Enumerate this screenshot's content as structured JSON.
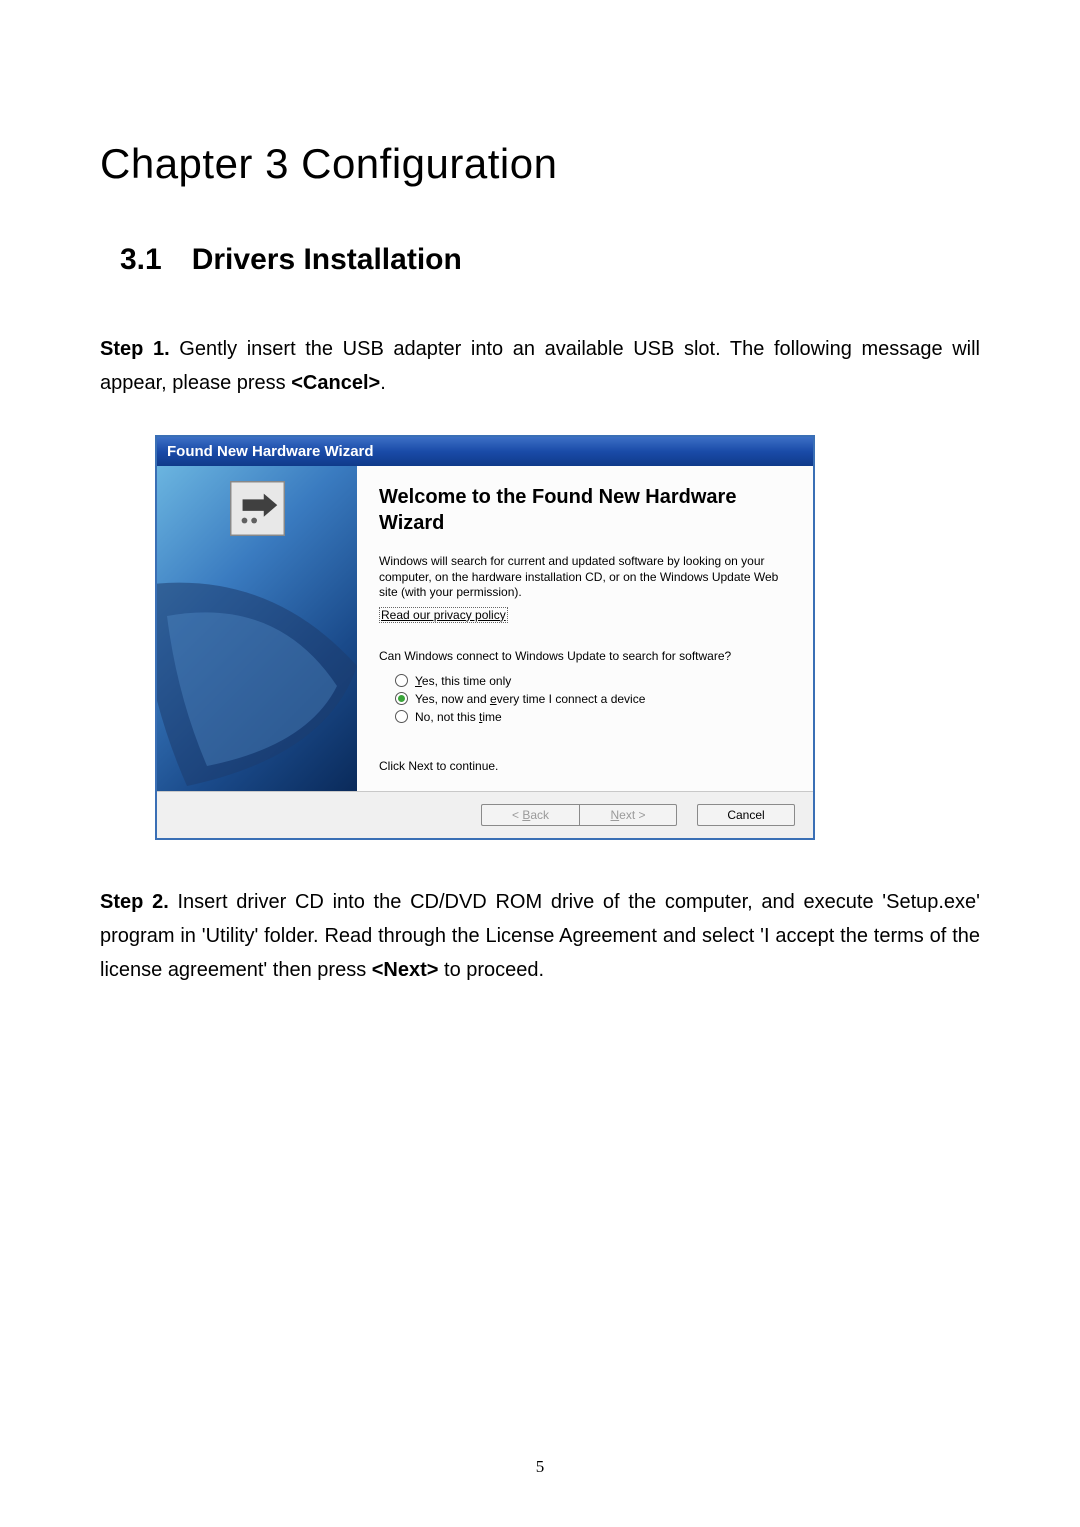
{
  "chapter": {
    "title": "Chapter 3   Configuration"
  },
  "section": {
    "number": "3.1",
    "title": "Drivers Installation"
  },
  "step1": {
    "label": "Step 1.",
    "text_before_bold": " Gently insert the USB adapter into an available USB slot. The following message will appear, please press ",
    "bold_text": "<Cancel>",
    "text_after_bold": "."
  },
  "wizard": {
    "titlebar": "Found New Hardware Wizard",
    "heading": "Welcome to the Found New Hardware Wizard",
    "intro_para": "Windows will search for current and updated software by looking on your computer, on the hardware installation CD, or on the Windows Update Web site (with your permission).",
    "privacy_link": "Read our privacy policy",
    "question": "Can Windows connect to Windows Update to search for software?",
    "radio1_pre": "",
    "radio1_u": "Y",
    "radio1_post": "es, this time only",
    "radio2_pre": "Yes, now and ",
    "radio2_u": "e",
    "radio2_post": "very time I connect a device",
    "radio3_pre": "No, not this ",
    "radio3_u": "t",
    "radio3_post": "ime",
    "continue_text": "Click Next to continue.",
    "back_pre": "< ",
    "back_u": "B",
    "back_post": "ack",
    "next_u": "N",
    "next_post": "ext >",
    "cancel": "Cancel"
  },
  "step2": {
    "label": "Step 2.",
    "text1": " Insert driver CD into the CD/DVD ROM drive of the computer, and execute 'Setup.exe' program in 'Utility' folder. Read through the License Agreement and select 'I accept the terms of the license agreement' then press ",
    "bold_text": "<Next>",
    "text2": " to proceed."
  },
  "page_number": "5"
}
